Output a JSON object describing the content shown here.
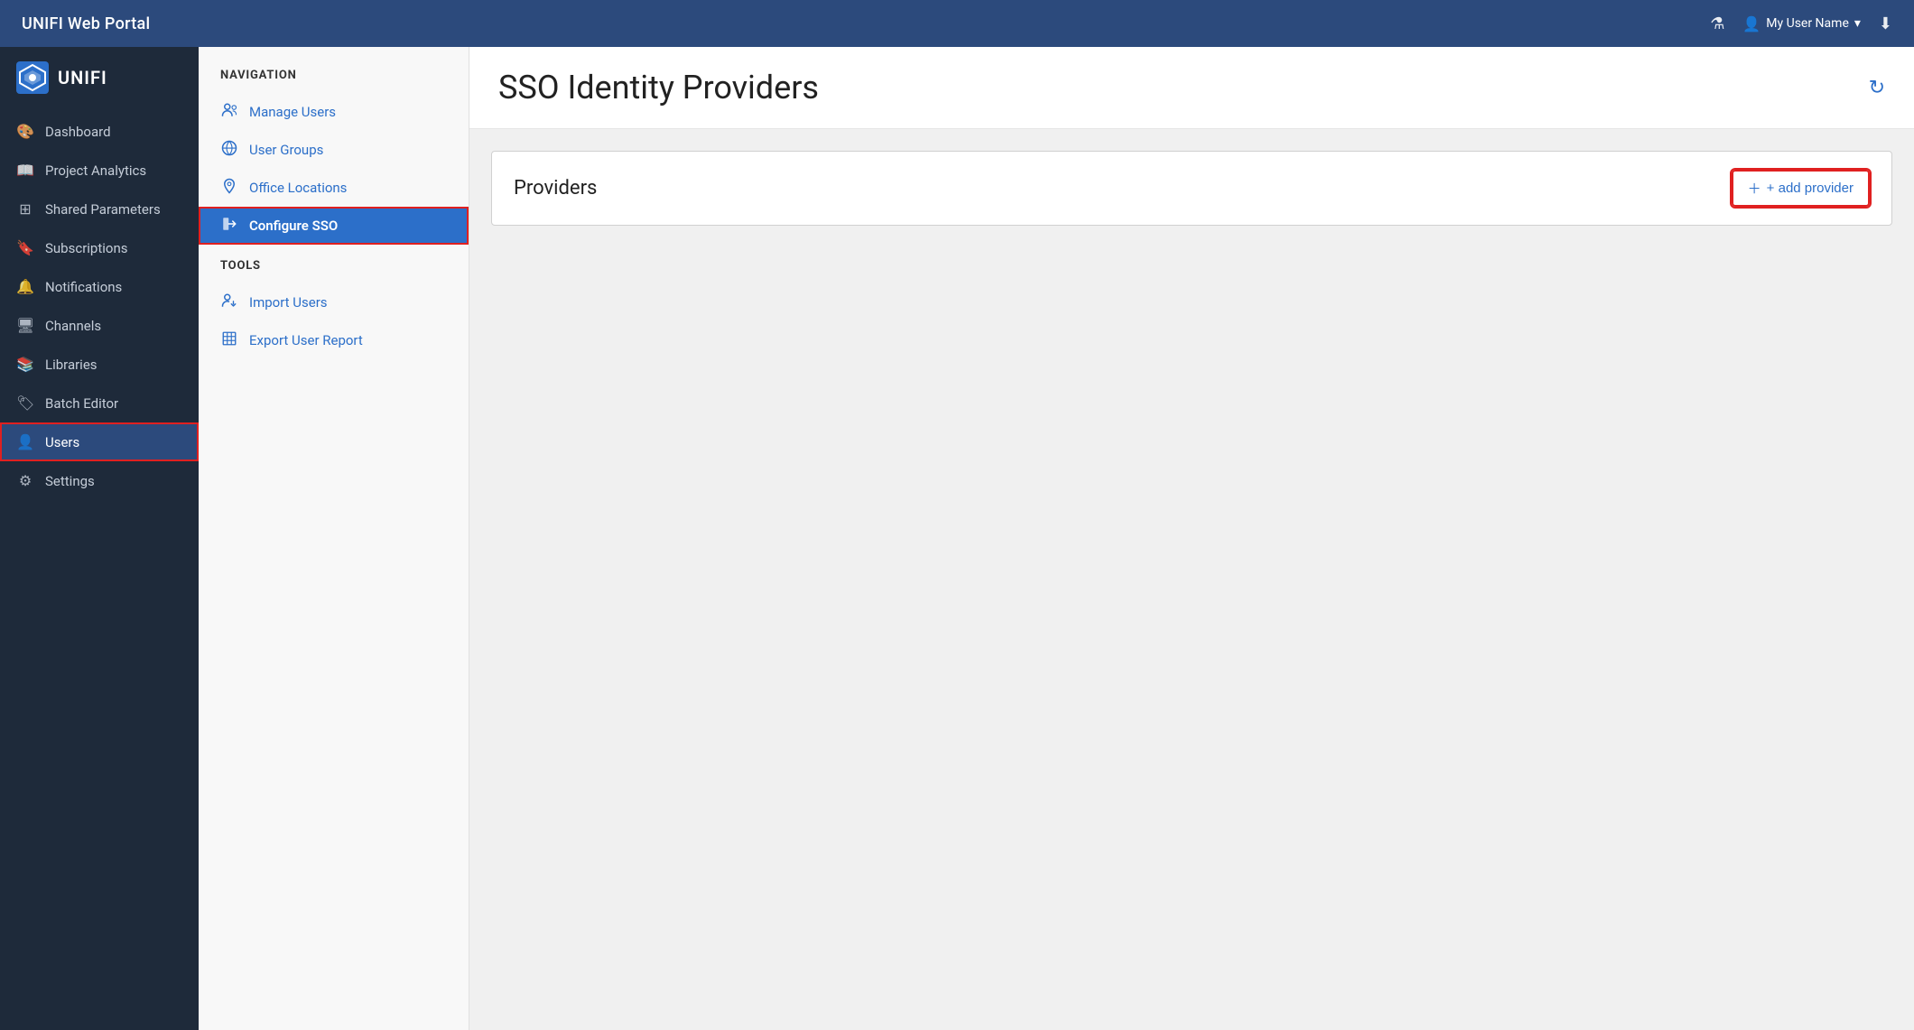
{
  "header": {
    "title": "UNIFI Web Portal",
    "user_label": "My User Name",
    "flask_icon": "🧪",
    "download_icon": "⬇"
  },
  "sidebar": {
    "logo_text": "UNIFI",
    "items": [
      {
        "id": "dashboard",
        "label": "Dashboard",
        "icon": "🎨"
      },
      {
        "id": "project-analytics",
        "label": "Project Analytics",
        "icon": "📖"
      },
      {
        "id": "shared-parameters",
        "label": "Shared Parameters",
        "icon": "⊞"
      },
      {
        "id": "subscriptions",
        "label": "Subscriptions",
        "icon": "🔖"
      },
      {
        "id": "notifications",
        "label": "Notifications",
        "icon": "🔔"
      },
      {
        "id": "channels",
        "label": "Channels",
        "icon": "🖥"
      },
      {
        "id": "libraries",
        "label": "Libraries",
        "icon": "📚"
      },
      {
        "id": "batch-editor",
        "label": "Batch Editor",
        "icon": "🏷"
      },
      {
        "id": "users",
        "label": "Users",
        "icon": "👤",
        "active": true,
        "highlighted": true
      },
      {
        "id": "settings",
        "label": "Settings",
        "icon": "⚙"
      }
    ]
  },
  "subnav": {
    "navigation_title": "NAVIGATION",
    "nav_items": [
      {
        "id": "manage-users",
        "label": "Manage Users",
        "icon": "👥"
      },
      {
        "id": "user-groups",
        "label": "User Groups",
        "icon": "🌐"
      },
      {
        "id": "office-locations",
        "label": "Office Locations",
        "icon": "📍"
      },
      {
        "id": "configure-sso",
        "label": "Configure SSO",
        "icon": "➡",
        "active": true,
        "highlighted": true
      }
    ],
    "tools_title": "TOOLS",
    "tools_items": [
      {
        "id": "import-users",
        "label": "Import Users",
        "icon": "➕👤"
      },
      {
        "id": "export-user-report",
        "label": "Export User Report",
        "icon": "⊞"
      }
    ]
  },
  "content": {
    "page_title": "SSO Identity Providers",
    "refresh_label": "↻",
    "providers_label": "Providers",
    "add_provider_label": "+ add provider"
  }
}
